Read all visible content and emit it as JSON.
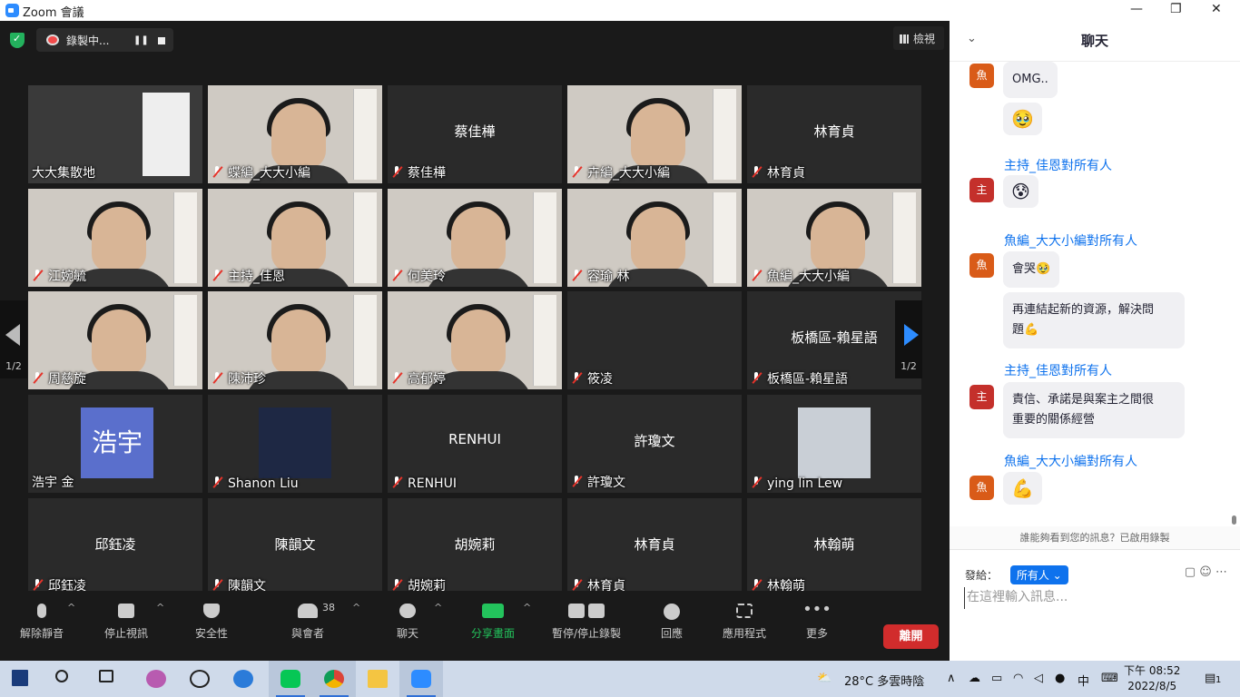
{
  "window": {
    "title": "Zoom 會議",
    "min": "—",
    "max": "❐",
    "close": "✕"
  },
  "top": {
    "recording": "錄製中...",
    "pause": "❚❚",
    "view": "檢視"
  },
  "tiles": [
    {
      "name": "大大集散地",
      "label": "大大集散地",
      "type": "video",
      "active": true,
      "muted": false
    },
    {
      "name": "蝶編_大大小編",
      "type": "video",
      "muted": true
    },
    {
      "name": "蔡佳樺",
      "center": "蔡佳樺",
      "type": "name",
      "muted": true
    },
    {
      "name": "卉編_大大小編",
      "type": "video",
      "muted": true
    },
    {
      "name": "林育貞",
      "center": "林育貞",
      "type": "name",
      "muted": true
    },
    {
      "name": "江婉毓",
      "type": "video",
      "muted": true
    },
    {
      "name": "主持_佳恩",
      "type": "video",
      "muted": true
    },
    {
      "name": "何美玲",
      "type": "video",
      "muted": true
    },
    {
      "name": "容瑜 林",
      "type": "video",
      "muted": true
    },
    {
      "name": "魚編_大大小編",
      "type": "video",
      "muted": true
    },
    {
      "name": "周慈旋",
      "type": "video",
      "muted": true
    },
    {
      "name": "陳沛珍",
      "type": "video",
      "muted": true
    },
    {
      "name": "高郁婷",
      "type": "video",
      "muted": true
    },
    {
      "name": "筱凌",
      "type": "blank",
      "muted": true
    },
    {
      "name": "板橋區-賴星語",
      "center": "板橋區-賴星語",
      "type": "name",
      "muted": true
    },
    {
      "name": "浩宇 金",
      "avatar": "浩宇",
      "type": "avatar",
      "muted": false
    },
    {
      "name": "Shanon Liu",
      "type": "img",
      "muted": true
    },
    {
      "name": "RENHUI",
      "center": "RENHUI",
      "type": "name",
      "muted": true
    },
    {
      "name": "許瓊文",
      "center": "許瓊文",
      "type": "name",
      "muted": true
    },
    {
      "name": "ying lin Lew",
      "type": "img",
      "muted": true
    },
    {
      "name": "邱鈺凌",
      "center": "邱鈺凌",
      "type": "name",
      "muted": true
    },
    {
      "name": "陳韻文",
      "center": "陳韻文",
      "type": "name",
      "muted": true
    },
    {
      "name": "胡婉莉",
      "center": "胡婉莉",
      "type": "name",
      "muted": true
    },
    {
      "name": "林育貞",
      "center": "林育貞",
      "type": "name",
      "muted": true
    },
    {
      "name": "林翰萌",
      "center": "林翰萌",
      "type": "name",
      "muted": true
    }
  ],
  "pager": {
    "left": "1/2",
    "right": "1/2"
  },
  "toolbar": {
    "unmute": "解除靜音",
    "stop_video": "停止視訊",
    "security": "安全性",
    "participants": "與會者",
    "participants_count": "38",
    "chat": "聊天",
    "share": "分享畫面",
    "pause_rec": "暫停/停止錄製",
    "reactions": "回應",
    "apps": "應用程式",
    "more": "更多",
    "leave": "離開"
  },
  "chat": {
    "title": "聊天",
    "messages": [
      {
        "avatar": "魚",
        "text": "OMG.."
      },
      {
        "emoji": "🥹"
      },
      {
        "sender": "主持_佳恩對所有人",
        "avatar": "主",
        "emoji": "😰"
      },
      {
        "sender": "魚編_大大小編對所有人",
        "avatar": "魚",
        "text": "會哭🥹"
      },
      {
        "text1": "再連結起新的資源，解決問",
        "text2": "題💪"
      },
      {
        "sender": "主持_佳恩對所有人",
        "avatar": "主",
        "text1": "責信、承諾是與案主之間很",
        "text2": "重要的關係經營"
      },
      {
        "sender": "魚編_大大小編對所有人",
        "avatar": "魚",
        "emoji": "💪"
      }
    ],
    "notice": "誰能夠看到您的訊息？已啟用錄製",
    "send_to_label": "發給：",
    "send_to": "所有人 ⌄",
    "placeholder": "在這裡輸入訊息..."
  },
  "taskbar": {
    "weather": "28°C  多雲時陰",
    "ime": "中",
    "time": "下午 08:52",
    "date": "2022/8/5",
    "notif": "1"
  },
  "colors": {
    "accent": "#0e72ed",
    "leave": "#d12c2c",
    "share": "#23c35c",
    "active_border": "#e7e36a"
  }
}
